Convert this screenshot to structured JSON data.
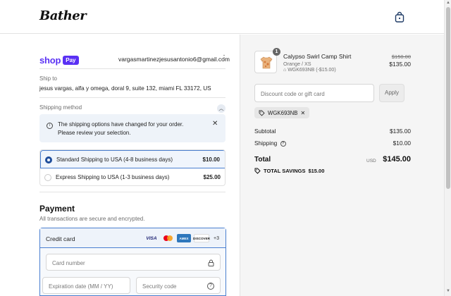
{
  "brand": {
    "logo_text": "Bather"
  },
  "header": {
    "cart_icon": "shopping-bag-icon"
  },
  "account": {
    "shop_pay_word": "shop",
    "shop_pay_badge": "Pay",
    "email": "vargasmartinezjesusantonio6@gmail.com",
    "menu_icon": "vertical-ellipsis-icon"
  },
  "ship_to": {
    "label": "Ship to",
    "address": "jesus vargas, alfa y omega, doral 9, suite 132, miami FL 33172, US"
  },
  "shipping_method": {
    "label": "Shipping method",
    "notice": "The shipping options have changed for your order. Please review your selection.",
    "notice_close": "✕",
    "options": [
      {
        "name": "Standard Shipping to USA (4-8 business days)",
        "price": "$10.00",
        "selected": true
      },
      {
        "name": "Express Shipping to USA (1-3 business days)",
        "price": "$25.00",
        "selected": false
      }
    ]
  },
  "payment": {
    "title": "Payment",
    "subtitle": "All transactions are secure and encrypted.",
    "method_label": "Credit card",
    "card_brands": [
      "VISA",
      "MC",
      "AMEX",
      "DISCOVER"
    ],
    "more_brands": "+3",
    "fields": {
      "card_number": "Card number",
      "expiration": "Expiration date (MM / YY)",
      "security_code": "Security code"
    }
  },
  "order": {
    "product": {
      "quantity": "1",
      "name": "Calypso Swirl Camp Shirt",
      "variant": "Orange / XS",
      "discount_line": "WGK693NB (-$15.00)",
      "price_original": "$150.00",
      "price": "$135.00"
    },
    "discount_placeholder": "Discount code or gift card",
    "apply_label": "Apply",
    "applied_code": "WGK693NB",
    "subtotal_label": "Subtotal",
    "subtotal": "$135.00",
    "shipping_label": "Shipping",
    "shipping": "$10.00",
    "total_label": "Total",
    "currency": "USD",
    "total": "$145.00",
    "savings_label": "TOTAL SAVINGS",
    "savings": "$15.00"
  },
  "colors": {
    "shop_pay": "#5a31f4",
    "selection_border": "#4a7fd0",
    "radio_selected": "#1f4e9c"
  }
}
